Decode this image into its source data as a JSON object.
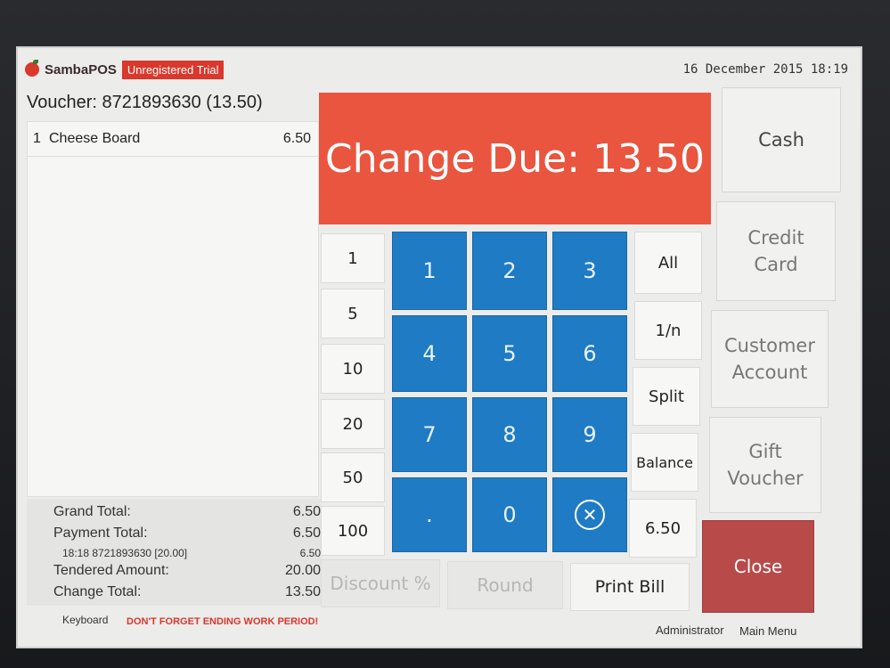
{
  "header": {
    "app_name": "SambaPOS",
    "trial_badge": "Unregistered Trial",
    "datetime": "16 December 2015 18:19"
  },
  "ticket": {
    "voucher": "Voucher: 8721893630 (13.50)",
    "orders": [
      {
        "qty": "1",
        "name": "Cheese Board",
        "price": "6.50"
      }
    ]
  },
  "totals": {
    "grand_total_label": "Grand Total:",
    "grand_total_value": "6.50",
    "payment_total_label": "Payment Total:",
    "payment_total_value": "6.50",
    "payment_detail_label": "18:18  8721893630 [20.00]",
    "payment_detail_value": "6.50",
    "tendered_label": "Tendered Amount:",
    "tendered_value": "20.00",
    "change_label": "Change Total:",
    "change_value": "13.50"
  },
  "banner": {
    "text": "Change Due: 13.50"
  },
  "quick_amounts": [
    "1",
    "5",
    "10",
    "20",
    "50",
    "100"
  ],
  "keypad": [
    "1",
    "2",
    "3",
    "4",
    "5",
    "6",
    "7",
    "8",
    "9",
    ".",
    "0"
  ],
  "keypad_clear_icon": "clear-icon",
  "split_buttons": [
    "All",
    "1/n",
    "Split",
    "Balance",
    "6.50"
  ],
  "payment_methods": {
    "cash": "Cash",
    "credit_card": "Credit Card",
    "customer_account": "Customer Account",
    "gift_voucher": "Gift Voucher",
    "close": "Close"
  },
  "bottom_buttons": {
    "discount": "Discount %",
    "round": "Round",
    "print_bill": "Print Bill"
  },
  "footer": {
    "keyboard": "Keyboard",
    "warning": "DON'T FORGET ENDING WORK PERIOD!",
    "user": "Administrator",
    "main_menu": "Main Menu"
  },
  "colors": {
    "accent_red": "#e9553f",
    "keypad_blue": "#1f7bc4",
    "close_red": "#b84a4a"
  }
}
